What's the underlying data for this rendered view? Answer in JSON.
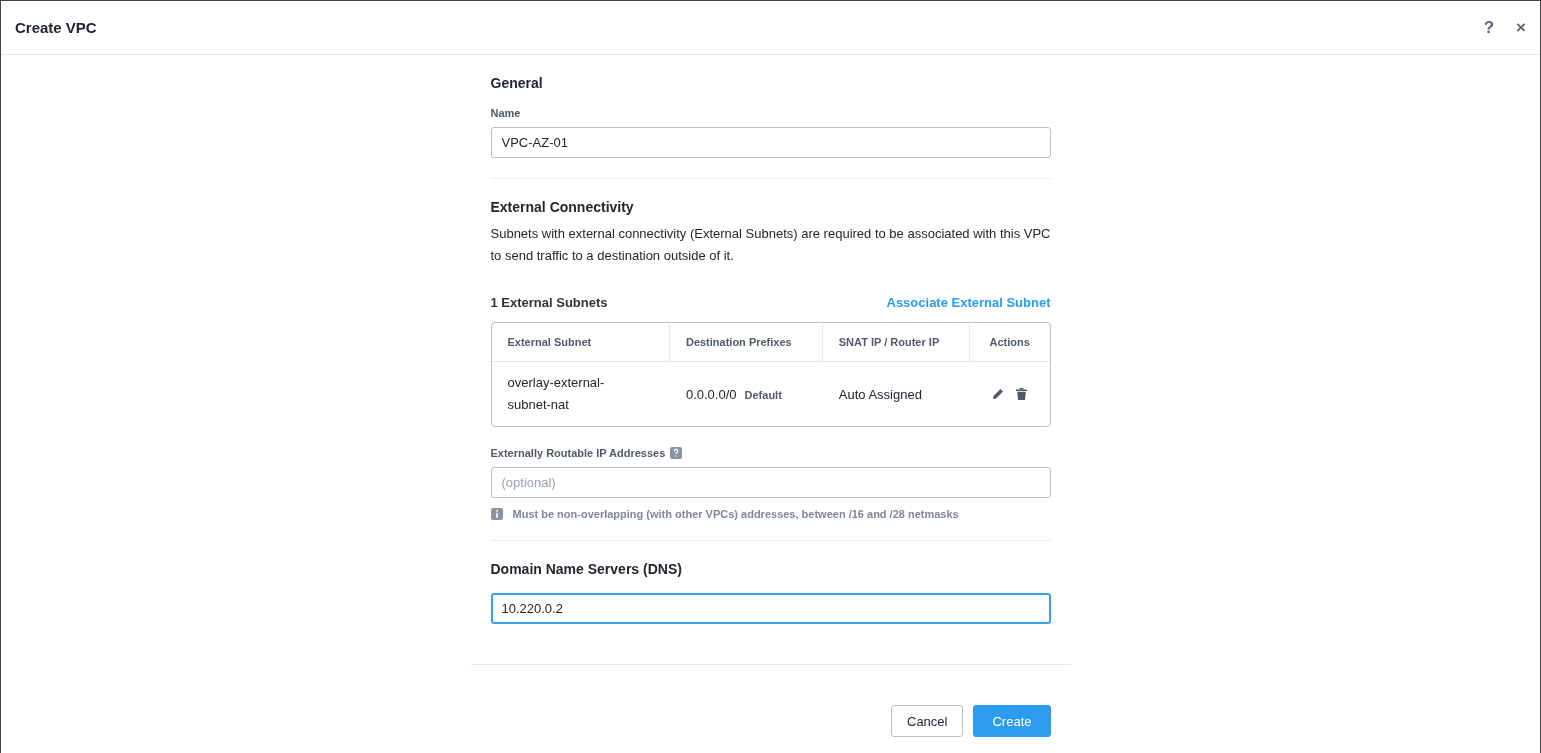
{
  "window": {
    "title": "Create VPC",
    "help": "?",
    "close": "×"
  },
  "general": {
    "heading": "General",
    "name_label": "Name",
    "name_value": "VPC-AZ-01",
    "focused": false
  },
  "external": {
    "heading": "External Connectivity",
    "description": "Subnets with external connectivity (External Subnets) are required to be associated with this VPC to send traffic to a destination outside of it.",
    "count_label": "1 External Subnets",
    "associate_link": "Associate External Subnet",
    "table": {
      "columns": [
        "External Subnet",
        "Destination Prefixes",
        "SNAT IP / Router IP",
        "Actions"
      ],
      "rows": [
        {
          "subnet": "overlay-external-subnet-nat",
          "prefix": "0.0.0.0/0",
          "prefix_tag": "Default",
          "snat": "Auto Assigned"
        }
      ]
    },
    "routable_label": "Externally Routable IP Addresses",
    "routable_placeholder": "(optional)",
    "routable_focused": false,
    "hint": "Must be non-overlapping (with other VPCs) addresses, between /16 and /28 netmasks"
  },
  "dns": {
    "heading": "Domain Name Servers (DNS)",
    "value": "10.220.0.2",
    "focused": true
  },
  "buttons": [
    {
      "label": "Cancel",
      "kind": "secondary"
    },
    {
      "label": "Create",
      "kind": "primary"
    }
  ]
}
